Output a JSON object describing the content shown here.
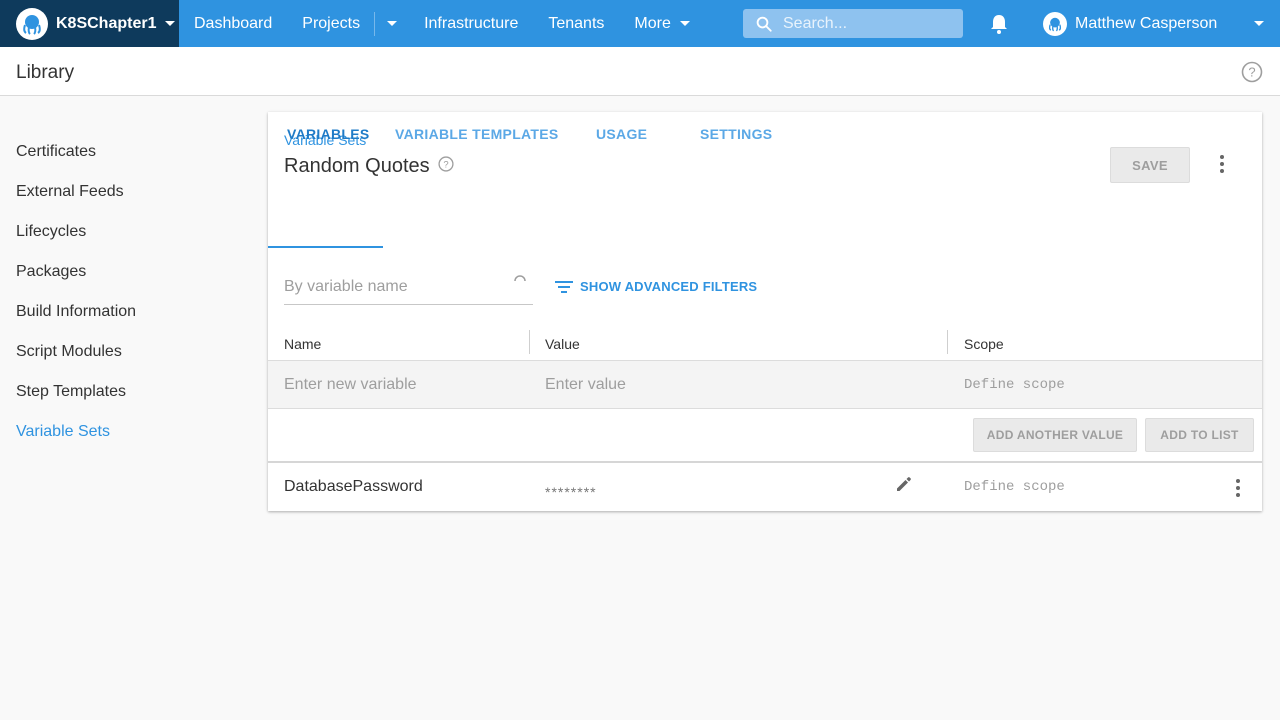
{
  "nav": {
    "space_name": "K8SChapter1",
    "items": [
      "Dashboard",
      "Projects",
      "Infrastructure",
      "Tenants",
      "More"
    ],
    "search_placeholder": "Search...",
    "user_name": "Matthew Casperson",
    "bar_color": "#2f93e0",
    "space_bg_color": "#0e3a5c"
  },
  "header": {
    "title": "Library"
  },
  "sidebar": {
    "items": [
      {
        "label": "Certificates"
      },
      {
        "label": "External Feeds"
      },
      {
        "label": "Lifecycles"
      },
      {
        "label": "Packages"
      },
      {
        "label": "Build Information"
      },
      {
        "label": "Script Modules"
      },
      {
        "label": "Step Templates"
      },
      {
        "label": "Variable Sets",
        "active": true
      }
    ]
  },
  "card": {
    "breadcrumb": "Variable Sets",
    "title": "Random Quotes",
    "save_label": "SAVE",
    "tabs": [
      "VARIABLES",
      "VARIABLE TEMPLATES",
      "USAGE",
      "SETTINGS"
    ],
    "active_tab": "VARIABLES",
    "filter_placeholder": "By variable name",
    "advanced_filters_label": "SHOW ADVANCED FILTERS",
    "columns": [
      "Name",
      "Value",
      "Scope"
    ],
    "new_row": {
      "name_placeholder": "Enter new variable",
      "value_placeholder": "Enter value",
      "scope_placeholder": "Define scope"
    },
    "add_another_value_label": "ADD ANOTHER VALUE",
    "add_to_list_label": "ADD TO LIST",
    "variables": [
      {
        "name": "DatabasePassword",
        "value": "********",
        "scope": "Define scope"
      }
    ]
  }
}
